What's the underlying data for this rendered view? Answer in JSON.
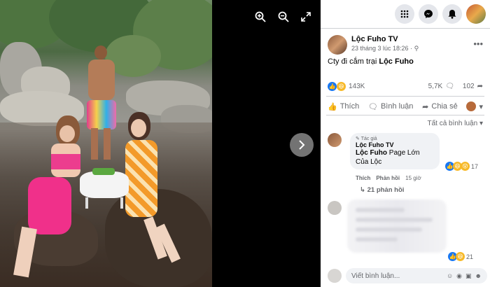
{
  "viewer": {
    "zoom_in_icon": "zoom-in-icon",
    "zoom_out_icon": "zoom-out-icon",
    "fullscreen_icon": "expand-icon",
    "next_icon": "chevron-right-icon"
  },
  "topbar": {
    "menu_icon": "grid-icon",
    "messenger_icon": "messenger-icon",
    "notification_icon": "bell-icon"
  },
  "post": {
    "author": "Lộc Fuho TV",
    "time": "23 tháng 3 lúc 18:26",
    "caption_prefix": "Cty đi cắm trại ",
    "caption_tag": "Lộc Fuho",
    "reactions": "143K",
    "comments": "5,7K",
    "shares": "102",
    "like_label": "Thích",
    "comment_label": "Bình luận",
    "share_label": "Chia sẻ"
  },
  "comments_section": {
    "filter_label": "Tất cả bình luận"
  },
  "comment": {
    "author_tag": "Tác giả",
    "name": "Lộc Fuho TV",
    "text_tag": "Lộc Fuho",
    "text": " Page Lớn Của Lộc",
    "reaction_count": "17",
    "like": "Thích",
    "reply": "Phản hồi",
    "time": "15 giờ",
    "replies": "21 phản hồi"
  },
  "blurred_comment": {
    "reaction_count": "21"
  },
  "composer": {
    "placeholder": "Viết bình luận..."
  }
}
